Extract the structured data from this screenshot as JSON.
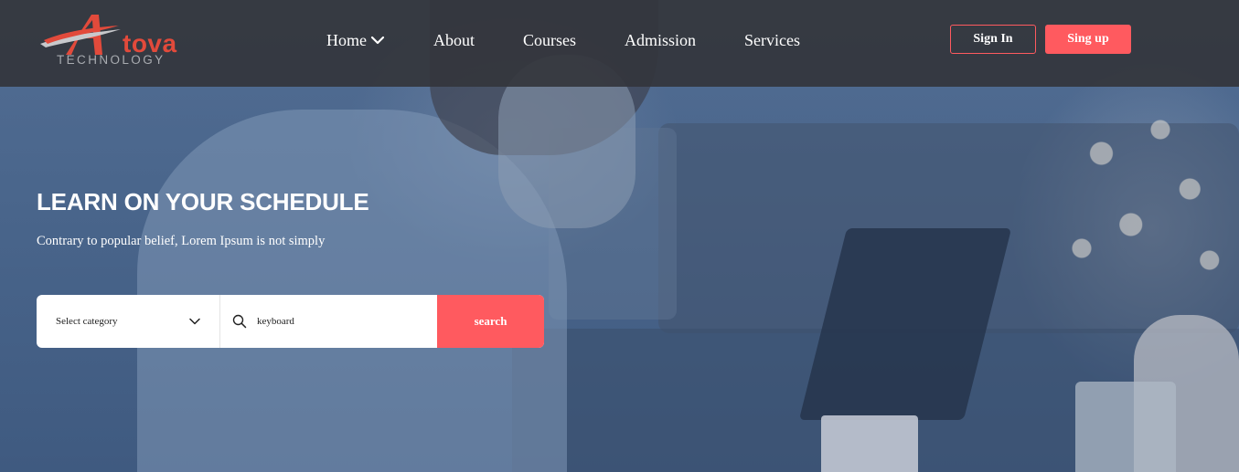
{
  "brand": {
    "name": "tova",
    "tagline": "TECHNOLOGY",
    "accent_color": "#e24a3b",
    "logo_icon": "a-swoosh-logo-icon"
  },
  "nav": {
    "items": [
      {
        "label": "Home",
        "has_dropdown": true
      },
      {
        "label": "About"
      },
      {
        "label": "Courses"
      },
      {
        "label": "Admission"
      },
      {
        "label": "Services"
      }
    ]
  },
  "auth": {
    "signin_label": "Sign In",
    "signup_label": "Sing up",
    "button_color": "#ff5a5f"
  },
  "hero": {
    "title": "LEARN ON YOUR SCHEDULE",
    "subtitle": "Contrary to popular belief, Lorem Ipsum is not simply"
  },
  "search": {
    "category_value": "Select category",
    "query_value": "keyboard",
    "button_label": "search",
    "icons": [
      "chevron-down-icon",
      "search-icon"
    ]
  }
}
